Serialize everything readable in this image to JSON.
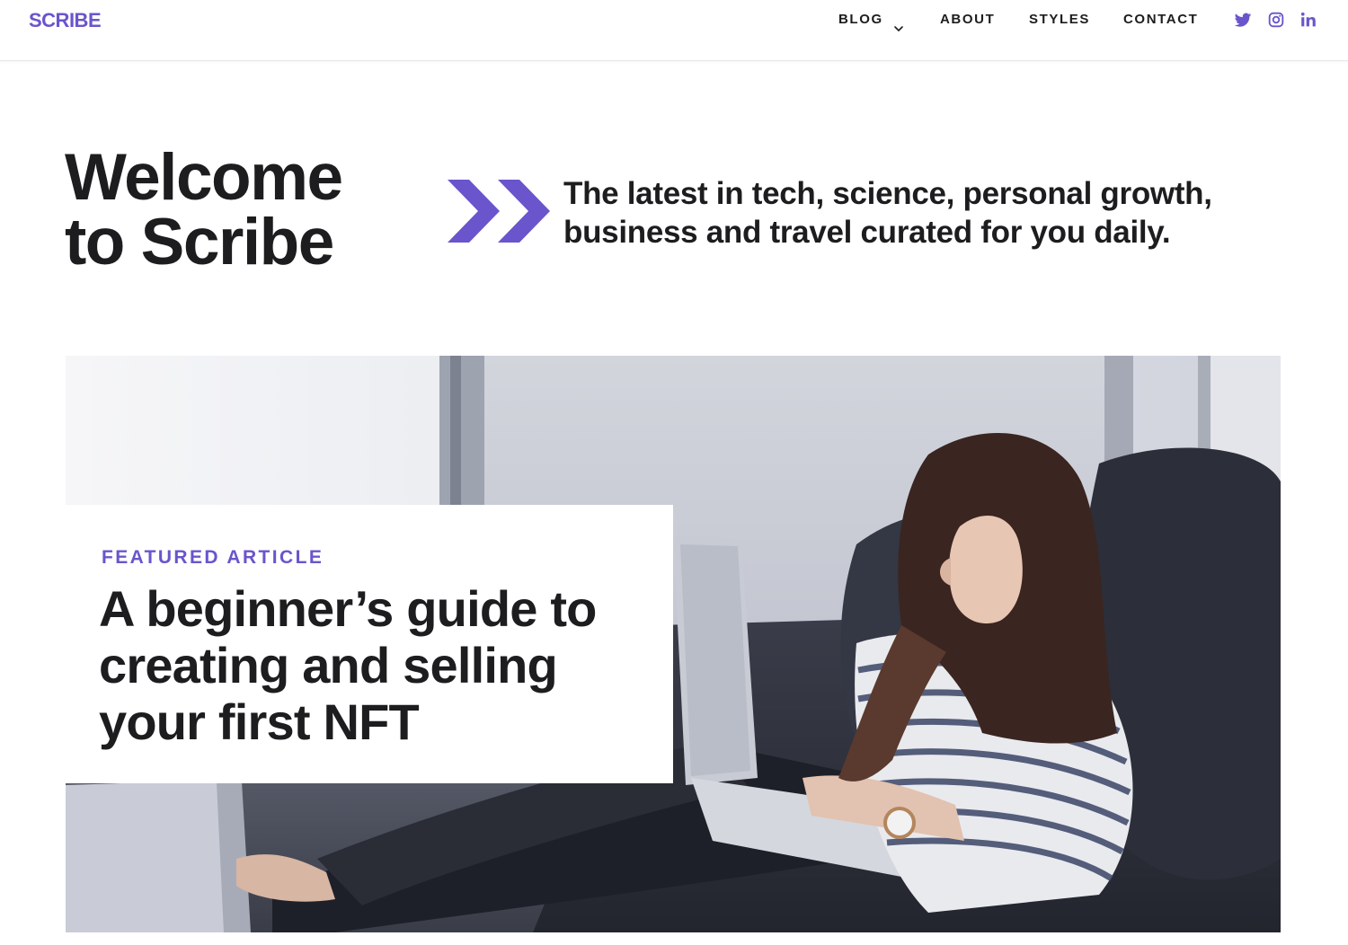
{
  "brand": {
    "name": "SCRIBE",
    "accent_color": "#6a55cc"
  },
  "nav": {
    "items": [
      {
        "label": "BLOG",
        "has_dropdown": true,
        "icon": "chevron-down-icon"
      },
      {
        "label": "ABOUT"
      },
      {
        "label": "STYLES"
      },
      {
        "label": "CONTACT"
      }
    ],
    "social": [
      {
        "icon": "twitter-icon"
      },
      {
        "icon": "instagram-icon"
      },
      {
        "icon": "linkedin-icon"
      }
    ]
  },
  "hero": {
    "title_line1": "Welcome",
    "title_line2": "to Scribe",
    "arrow_icon": "double-chevron-right-icon",
    "tagline": "The latest in tech, science, personal growth, business and travel curated for you daily."
  },
  "featured": {
    "kicker": "FEATURED ARTICLE",
    "title": "A beginner’s guide to creating and selling your first NFT",
    "image": "photo-woman-with-laptop-on-sofa"
  }
}
